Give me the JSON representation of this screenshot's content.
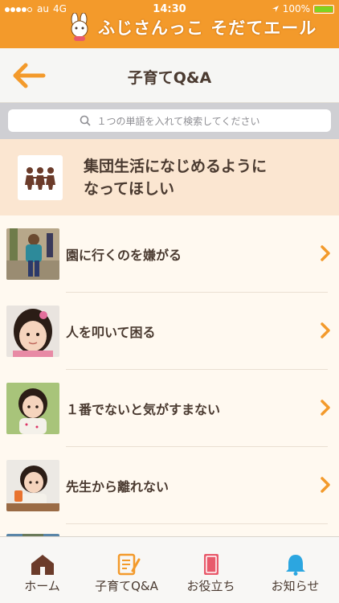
{
  "status_bar": {
    "carrier": "au",
    "network": "4G",
    "time": "14:30",
    "battery": "100%",
    "battery_level": 1.0
  },
  "brand": {
    "name": "ふじさんっこ そだてエール"
  },
  "nav": {
    "title": "子育てQ&A",
    "back_icon": "back-arrow-icon"
  },
  "search": {
    "placeholder": "１つの単語を入れて検索してください"
  },
  "category": {
    "title": "集団生活になじめるように\nなってほしい",
    "icon": "children-group-icon"
  },
  "items": [
    {
      "label": "園に行くのを嫌がる"
    },
    {
      "label": "人を叩いて困る"
    },
    {
      "label": "１番でないと気がすまない"
    },
    {
      "label": "先生から離れない"
    }
  ],
  "tabs": [
    {
      "label": "ホーム",
      "icon": "home-icon"
    },
    {
      "label": "子育てQ&A",
      "icon": "qa-notebook-icon"
    },
    {
      "label": "お役立ち",
      "icon": "book-icon"
    },
    {
      "label": "お知らせ",
      "icon": "bell-icon"
    }
  ],
  "colors": {
    "accent": "#f39a2b",
    "text": "#4a3a30",
    "category_bg": "#fbe6d1"
  }
}
